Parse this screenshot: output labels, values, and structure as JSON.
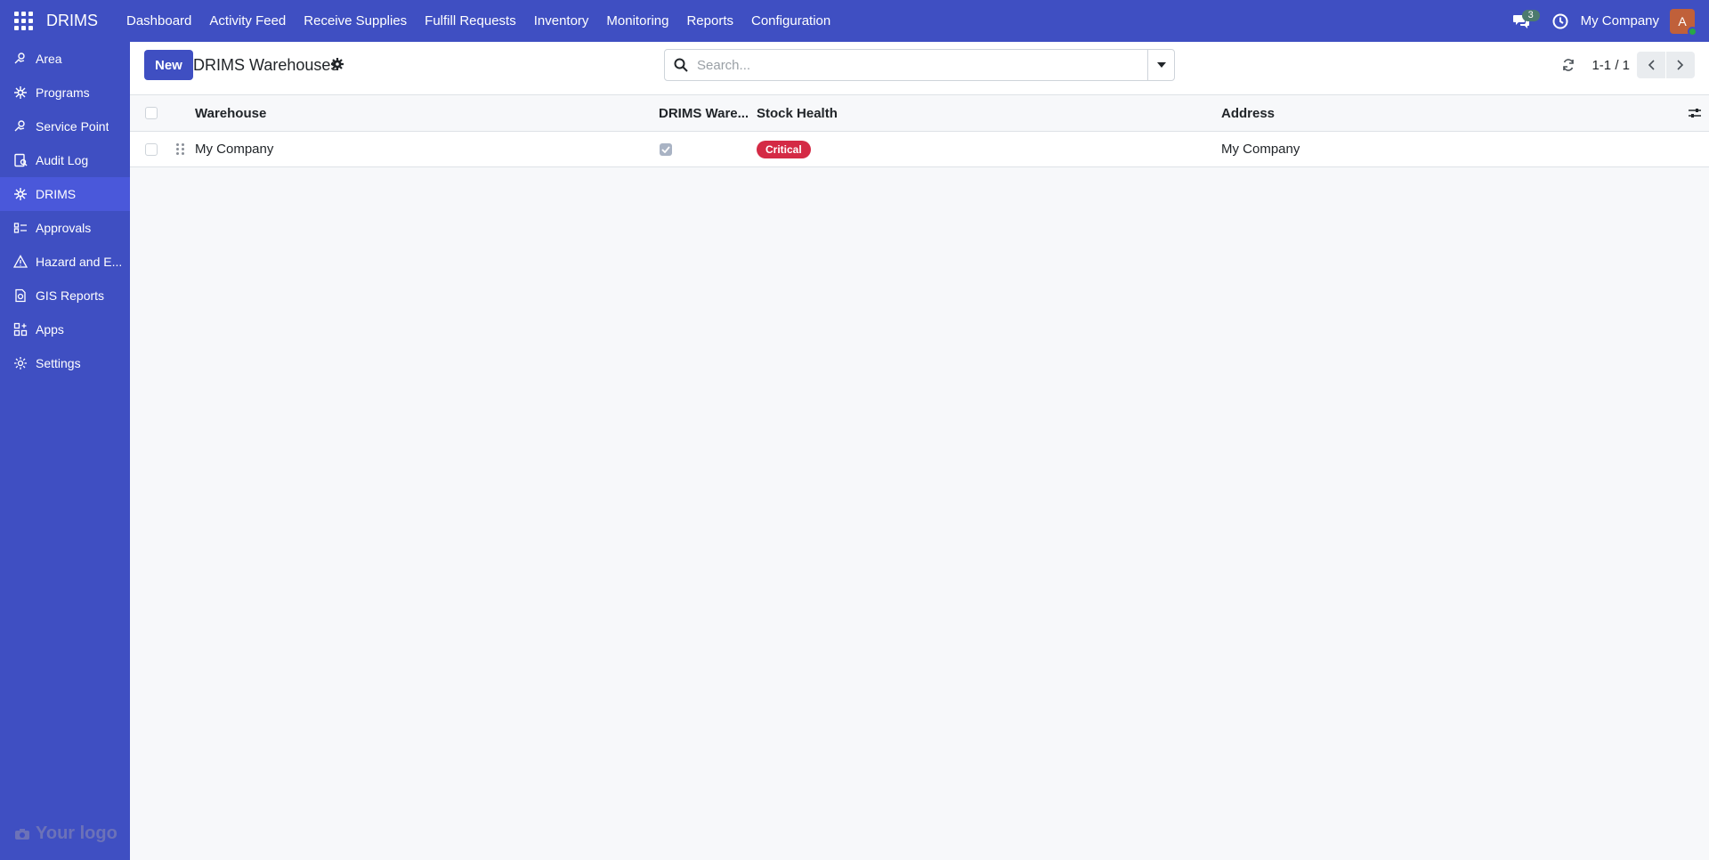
{
  "app": {
    "brand": "DRIMS"
  },
  "topmenu": [
    "Dashboard",
    "Activity Feed",
    "Receive Supplies",
    "Fulfill Requests",
    "Inventory",
    "Monitoring",
    "Reports",
    "Configuration"
  ],
  "topbar": {
    "chat_count": "3",
    "company": "My Company",
    "avatar_letter": "A"
  },
  "sidebar": {
    "items": [
      {
        "label": "Area",
        "icon": "area-icon"
      },
      {
        "label": "Programs",
        "icon": "programs-icon"
      },
      {
        "label": "Service Point",
        "icon": "service-point-icon"
      },
      {
        "label": "Audit Log",
        "icon": "audit-log-icon"
      },
      {
        "label": "DRIMS",
        "icon": "drims-icon"
      },
      {
        "label": "Approvals",
        "icon": "approvals-icon"
      },
      {
        "label": "Hazard and E...",
        "icon": "hazard-icon"
      },
      {
        "label": "GIS Reports",
        "icon": "gis-reports-icon"
      },
      {
        "label": "Apps",
        "icon": "apps-icon"
      },
      {
        "label": "Settings",
        "icon": "settings-icon"
      }
    ],
    "active": "DRIMS",
    "logo_text": "Your logo"
  },
  "control": {
    "new_label": "New",
    "title": "DRIMS Warehouses",
    "search_placeholder": "Search...",
    "pager": "1-1 / 1"
  },
  "table": {
    "columns": [
      "Warehouse",
      "DRIMS Ware...",
      "Stock Health",
      "Address"
    ],
    "rows": [
      {
        "warehouse": "My Company",
        "drims_warehouse": true,
        "stock_health": "Critical",
        "address": "My Company"
      }
    ]
  },
  "colors": {
    "primary": "#3f4fc2",
    "active_sidebar": "#4a58da",
    "critical": "#d42a45"
  }
}
